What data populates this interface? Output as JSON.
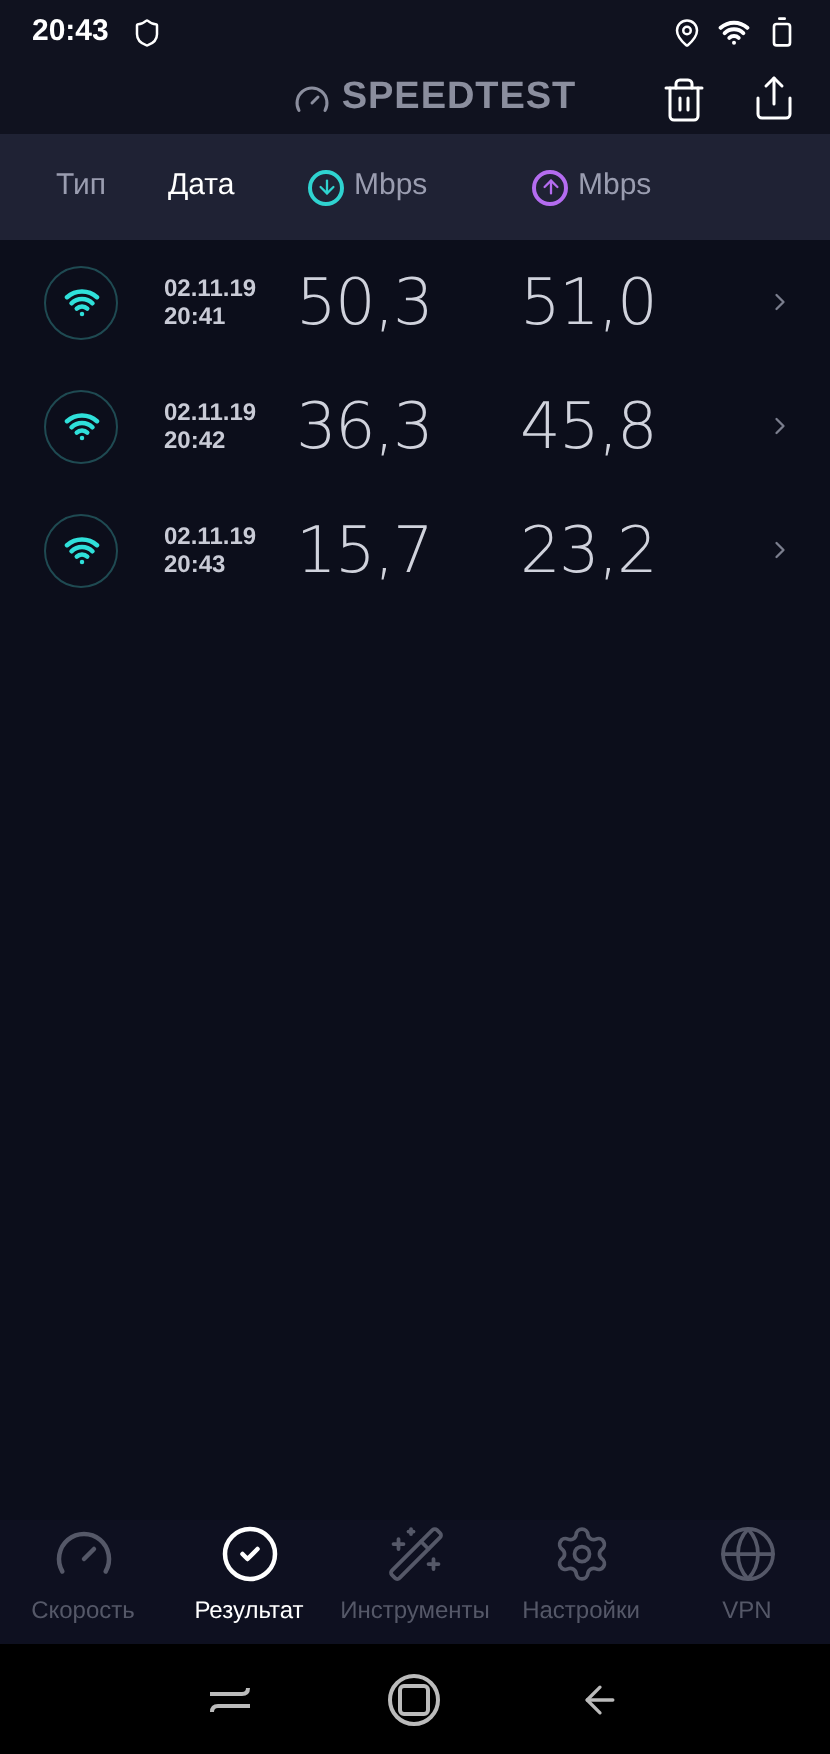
{
  "status_bar": {
    "time": "20:43"
  },
  "app_bar": {
    "title": "SPEEDTEST"
  },
  "columns": [
    {
      "kind": "text",
      "label": "Тип",
      "selected": false
    },
    {
      "kind": "text",
      "label": "Дата",
      "selected": true
    },
    {
      "kind": "download",
      "label": "Mbps",
      "selected": false
    },
    {
      "kind": "upload",
      "label": "Mbps",
      "selected": false
    }
  ],
  "results": [
    {
      "date": "02.11.19",
      "time": "20:41",
      "download": "50,3",
      "upload": "51,0"
    },
    {
      "date": "02.11.19",
      "time": "20:42",
      "download": "36,3",
      "upload": "45,8"
    },
    {
      "date": "02.11.19",
      "time": "20:43",
      "download": "15,7",
      "upload": "23,2"
    }
  ],
  "tabs": [
    {
      "kind": "speed",
      "label": "Скорость",
      "selected": false
    },
    {
      "kind": "results",
      "label": "Результат",
      "selected": true
    },
    {
      "kind": "tools",
      "label": "Инструменты",
      "selected": false
    },
    {
      "kind": "settings",
      "label": "Настройки",
      "selected": false
    },
    {
      "kind": "vpn",
      "label": "VPN",
      "selected": false
    }
  ]
}
